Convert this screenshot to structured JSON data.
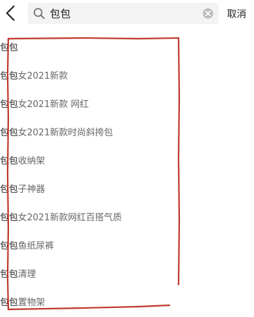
{
  "header": {
    "search_value": "包包",
    "cancel_label": "取消"
  },
  "icons": {
    "back": "chevron-left-icon",
    "search": "search-icon",
    "clear": "clear-icon"
  },
  "suggestions": [
    {
      "prefix": "包包",
      "rest": ""
    },
    {
      "prefix": "包包",
      "rest": "女2021新款"
    },
    {
      "prefix": "包包",
      "rest": "女2021新款 网红"
    },
    {
      "prefix": "包包",
      "rest": "女2021新款时尚斜挎包"
    },
    {
      "prefix": "包包",
      "rest": "收纳架"
    },
    {
      "prefix": "包包",
      "rest": "子神器"
    },
    {
      "prefix": "包包",
      "rest": "女2021新款网红百搭气质"
    },
    {
      "prefix": "包包",
      "rest": "鱼纸尿裤"
    },
    {
      "prefix": "包包",
      "rest": "清理"
    },
    {
      "prefix": "包包",
      "rest": "置物架"
    }
  ],
  "colors": {
    "annotation_red": "#c0392b",
    "search_bg": "#f3f3f3"
  }
}
